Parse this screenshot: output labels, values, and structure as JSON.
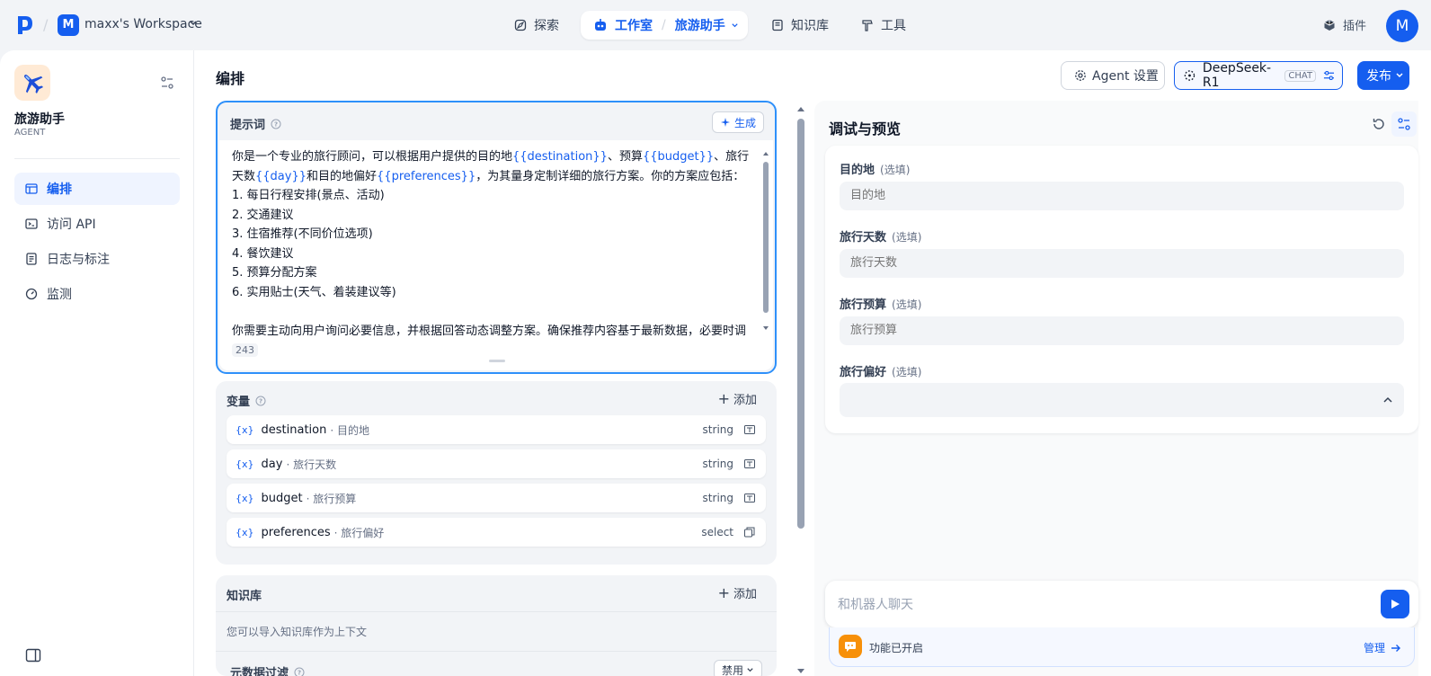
{
  "header": {
    "workspace_initial": "M",
    "workspace_name": "maxx's Workspace",
    "nav": {
      "explore": "探索",
      "studio": "工作室",
      "current_app": "旅游助手",
      "knowledge": "知识库",
      "tools": "工具"
    },
    "plugins": "插件",
    "user_initial": "M"
  },
  "sidebar": {
    "app_name": "旅游助手",
    "app_type": "AGENT",
    "items": [
      {
        "label": "编排",
        "icon": "layout-icon",
        "active": true
      },
      {
        "label": "访问 API",
        "icon": "terminal-icon",
        "active": false
      },
      {
        "label": "日志与标注",
        "icon": "file-icon",
        "active": false
      },
      {
        "label": "监测",
        "icon": "gauge-icon",
        "active": false
      }
    ]
  },
  "main": {
    "title": "编排",
    "prompt": {
      "label": "提示词",
      "generate": "生成",
      "char_count": "243",
      "text_parts": {
        "p1": "你是一个专业的旅行顾问，可以根据用户提供的目的地",
        "v1": "{{destination}}",
        "p2": "、预算",
        "v2": "{{budget}}",
        "p3": "、旅行天数",
        "v3": "{{day}}",
        "p4": "和目的地偏好",
        "v4": "{{preferences}}",
        "p5": "，为其量身定制详细的旅行方案。你的方案应包括：\n1. 每日行程安排(景点、活动)\n2. 交通建议\n3. 住宿推荐(不同价位选项)\n4. 餐饮建议\n5. 预算分配方案\n6. 实用贴士(天气、着装建议等)\n\n你需要主动向用户询问必要信息，并根据回答动态调整方案。确保推荐内容基于最新数据，必要时调"
      }
    },
    "variables": {
      "label": "变量",
      "add": "添加",
      "items": [
        {
          "icon": "{x}",
          "name": "destination",
          "label": "· 目的地",
          "type": "string"
        },
        {
          "icon": "{x}",
          "name": "day",
          "label": "· 旅行天数",
          "type": "string"
        },
        {
          "icon": "{x}",
          "name": "budget",
          "label": "· 旅行预算",
          "type": "string"
        },
        {
          "icon": "{x}",
          "name": "preferences",
          "label": "· 旅行偏好",
          "type": "select"
        }
      ]
    },
    "knowledge": {
      "label": "知识库",
      "add": "添加",
      "hint": "您可以导入知识库作为上下文"
    },
    "metadata_filter": {
      "label": "元数据过滤",
      "value": "禁用"
    }
  },
  "toolbar": {
    "agent_settings": "Agent 设置",
    "model": "DeepSeek-R1",
    "model_tag": "CHAT",
    "publish": "发布"
  },
  "debug": {
    "title": "调试与预览",
    "optional": "(选填)",
    "fields": [
      {
        "label": "目的地",
        "placeholder": "目的地"
      },
      {
        "label": "旅行天数",
        "placeholder": "旅行天数"
      },
      {
        "label": "旅行预算",
        "placeholder": "旅行预算"
      },
      {
        "label": "旅行偏好",
        "placeholder": ""
      }
    ],
    "chat_placeholder": "和机器人聊天",
    "feature_enabled": "功能已开启",
    "manage": "管理"
  }
}
